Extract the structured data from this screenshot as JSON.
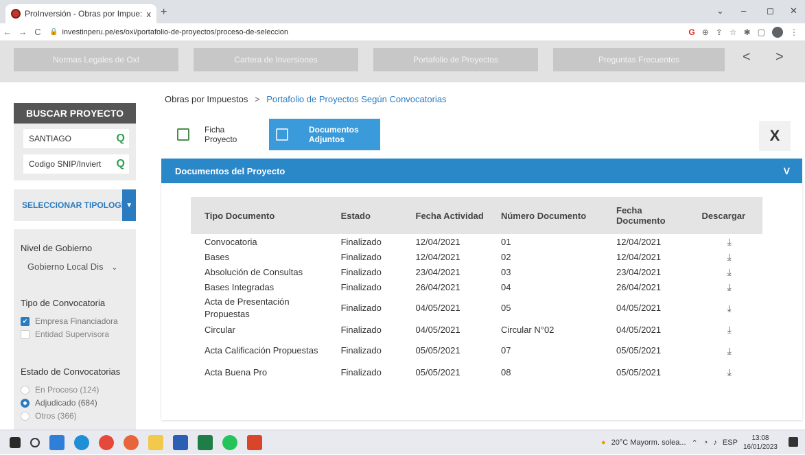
{
  "browser": {
    "tab_title": "ProInversión - Obras por Impue:",
    "tab_close": "x",
    "new_tab": "+",
    "url": "investinperu.pe/es/oxi/portafolio-de-proyectos/proceso-de-seleccion",
    "win_min": "–",
    "win_max": "◻",
    "win_close": "✕"
  },
  "sitenav": {
    "items": [
      "Normas Legales de OxI",
      "Cartera de Inversiones",
      "Portafolio de Proyectos",
      "Preguntas Frecuentes"
    ],
    "prev": "<",
    "next": ">"
  },
  "sidebar": {
    "title": "BUSCAR PROYECTO",
    "search_value": "SANTIAGO",
    "snip_placeholder": "Codigo SNIP/Inviert",
    "tipologia": "SELECCIONAR TIPOLOGÍA",
    "nivel_title": "Nivel de Gobierno",
    "nivel_value": "Gobierno Local Dis",
    "tipo_title": "Tipo de Convocatoria",
    "tipo_options": [
      {
        "label": "Empresa Financiadora",
        "checked": true
      },
      {
        "label": "Entidad Supervisora",
        "checked": false
      }
    ],
    "estado_title": "Estado de Convocatorias",
    "estado_options": [
      {
        "label": "En Proceso (124)",
        "selected": false
      },
      {
        "label": "Adjudicado (684)",
        "selected": true
      },
      {
        "label": "Otros (366)",
        "selected": false
      }
    ]
  },
  "main": {
    "breadcrumb_root": "Obras por Impuestos",
    "breadcrumb_sep": ">",
    "breadcrumb_current": "Portafolio de Proyectos Según Convocatorias",
    "tab_ficha_1": "Ficha",
    "tab_ficha_2": "Proyecto",
    "tab_docs_1": "Documentos",
    "tab_docs_2": "Adjuntos",
    "close_label": "X",
    "section_title": "Documentos del Proyecto",
    "section_toggle": "V",
    "columns": [
      "Tipo Documento",
      "Estado",
      "Fecha Actividad",
      "Número Documento",
      "Fecha Documento",
      "Descargar"
    ],
    "rows": [
      {
        "tipo": "Convocatoria",
        "estado": "Finalizado",
        "fecha_act": "12/04/2021",
        "numero": "01",
        "fecha_doc": "12/04/2021"
      },
      {
        "tipo": "Bases",
        "estado": "Finalizado",
        "fecha_act": "12/04/2021",
        "numero": "02",
        "fecha_doc": "12/04/2021"
      },
      {
        "tipo": "Absolución de Consultas",
        "estado": "Finalizado",
        "fecha_act": "23/04/2021",
        "numero": "03",
        "fecha_doc": "23/04/2021"
      },
      {
        "tipo": "Bases Integradas",
        "estado": "Finalizado",
        "fecha_act": "26/04/2021",
        "numero": "04",
        "fecha_doc": "26/04/2021"
      },
      {
        "tipo": "Acta de Presentación Propuestas",
        "estado": "Finalizado",
        "fecha_act": "04/05/2021",
        "numero": "05",
        "fecha_doc": "04/05/2021"
      },
      {
        "tipo": "Circular",
        "estado": "Finalizado",
        "fecha_act": "04/05/2021",
        "numero": "Circular N°02",
        "fecha_doc": "04/05/2021"
      },
      {
        "tipo": "Acta Calificación Propuestas",
        "estado": "Finalizado",
        "fecha_act": "05/05/2021",
        "numero": "07",
        "fecha_doc": "05/05/2021"
      },
      {
        "tipo": "Acta Buena Pro",
        "estado": "Finalizado",
        "fecha_act": "05/05/2021",
        "numero": "08",
        "fecha_doc": "05/05/2021"
      }
    ],
    "download_icon": "download-icon"
  },
  "taskbar": {
    "weather": "20°C Mayorm. solea...",
    "lang": "ESP",
    "time": "13:08",
    "date": "16/01/2023"
  },
  "colors": {
    "accent": "#2a87c8",
    "tab_active": "#3b9ad9",
    "search_icon": "#2e9e4f"
  }
}
